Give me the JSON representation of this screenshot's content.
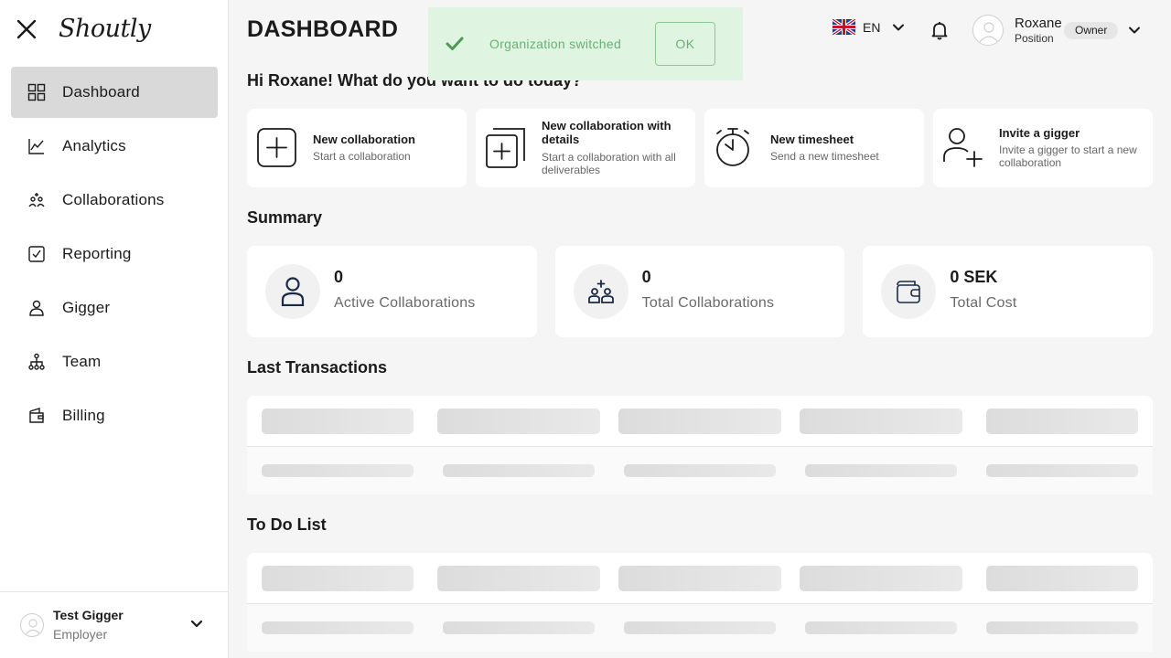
{
  "sidebar": {
    "logo": "Shoutly",
    "items": [
      {
        "label": "Dashboard",
        "icon": "dashboard-icon",
        "active": true
      },
      {
        "label": "Analytics",
        "icon": "analytics-icon"
      },
      {
        "label": "Collaborations",
        "icon": "collaborations-icon"
      },
      {
        "label": "Reporting",
        "icon": "reporting-icon"
      },
      {
        "label": "Gigger",
        "icon": "gigger-icon"
      },
      {
        "label": "Team",
        "icon": "team-icon"
      },
      {
        "label": "Billing",
        "icon": "billing-icon"
      }
    ],
    "account": {
      "name": "Test Gigger",
      "role": "Employer"
    }
  },
  "header": {
    "title": "DASHBOARD",
    "language": "EN",
    "user": {
      "name": "Roxane",
      "position": "Position",
      "badge": "Owner"
    }
  },
  "toast": {
    "message": "Organization switched",
    "button": "OK",
    "color": "#6ab074"
  },
  "greeting": "Hi Roxane! What do you want to do today?",
  "quick_actions": [
    {
      "title": "New collaboration",
      "subtitle": "Start a collaboration",
      "icon": "plus-square-icon"
    },
    {
      "title": "New collaboration with details",
      "subtitle": "Start a collaboration with all deliverables",
      "icon": "plus-stack-icon"
    },
    {
      "title": "New timesheet",
      "subtitle": "Send a new timesheet",
      "icon": "stopwatch-icon"
    },
    {
      "title": "Invite a gigger",
      "subtitle": "Invite a gigger to start a new collaboration",
      "icon": "user-plus-icon"
    }
  ],
  "summary": {
    "title": "Summary",
    "cards": [
      {
        "value": "0",
        "label": "Active Collaborations",
        "icon": "person-icon"
      },
      {
        "value": "0",
        "label": "Total Collaborations",
        "icon": "group-icon"
      },
      {
        "value": "0 SEK",
        "label": "Total Cost",
        "icon": "wallet-icon"
      }
    ]
  },
  "last_transactions": {
    "title": "Last Transactions"
  },
  "todo": {
    "title": "To Do List"
  },
  "colors": {
    "active_nav": "#d9d9d9",
    "toast_bg": "#e0f4e2",
    "background": "#f5f5f5"
  }
}
